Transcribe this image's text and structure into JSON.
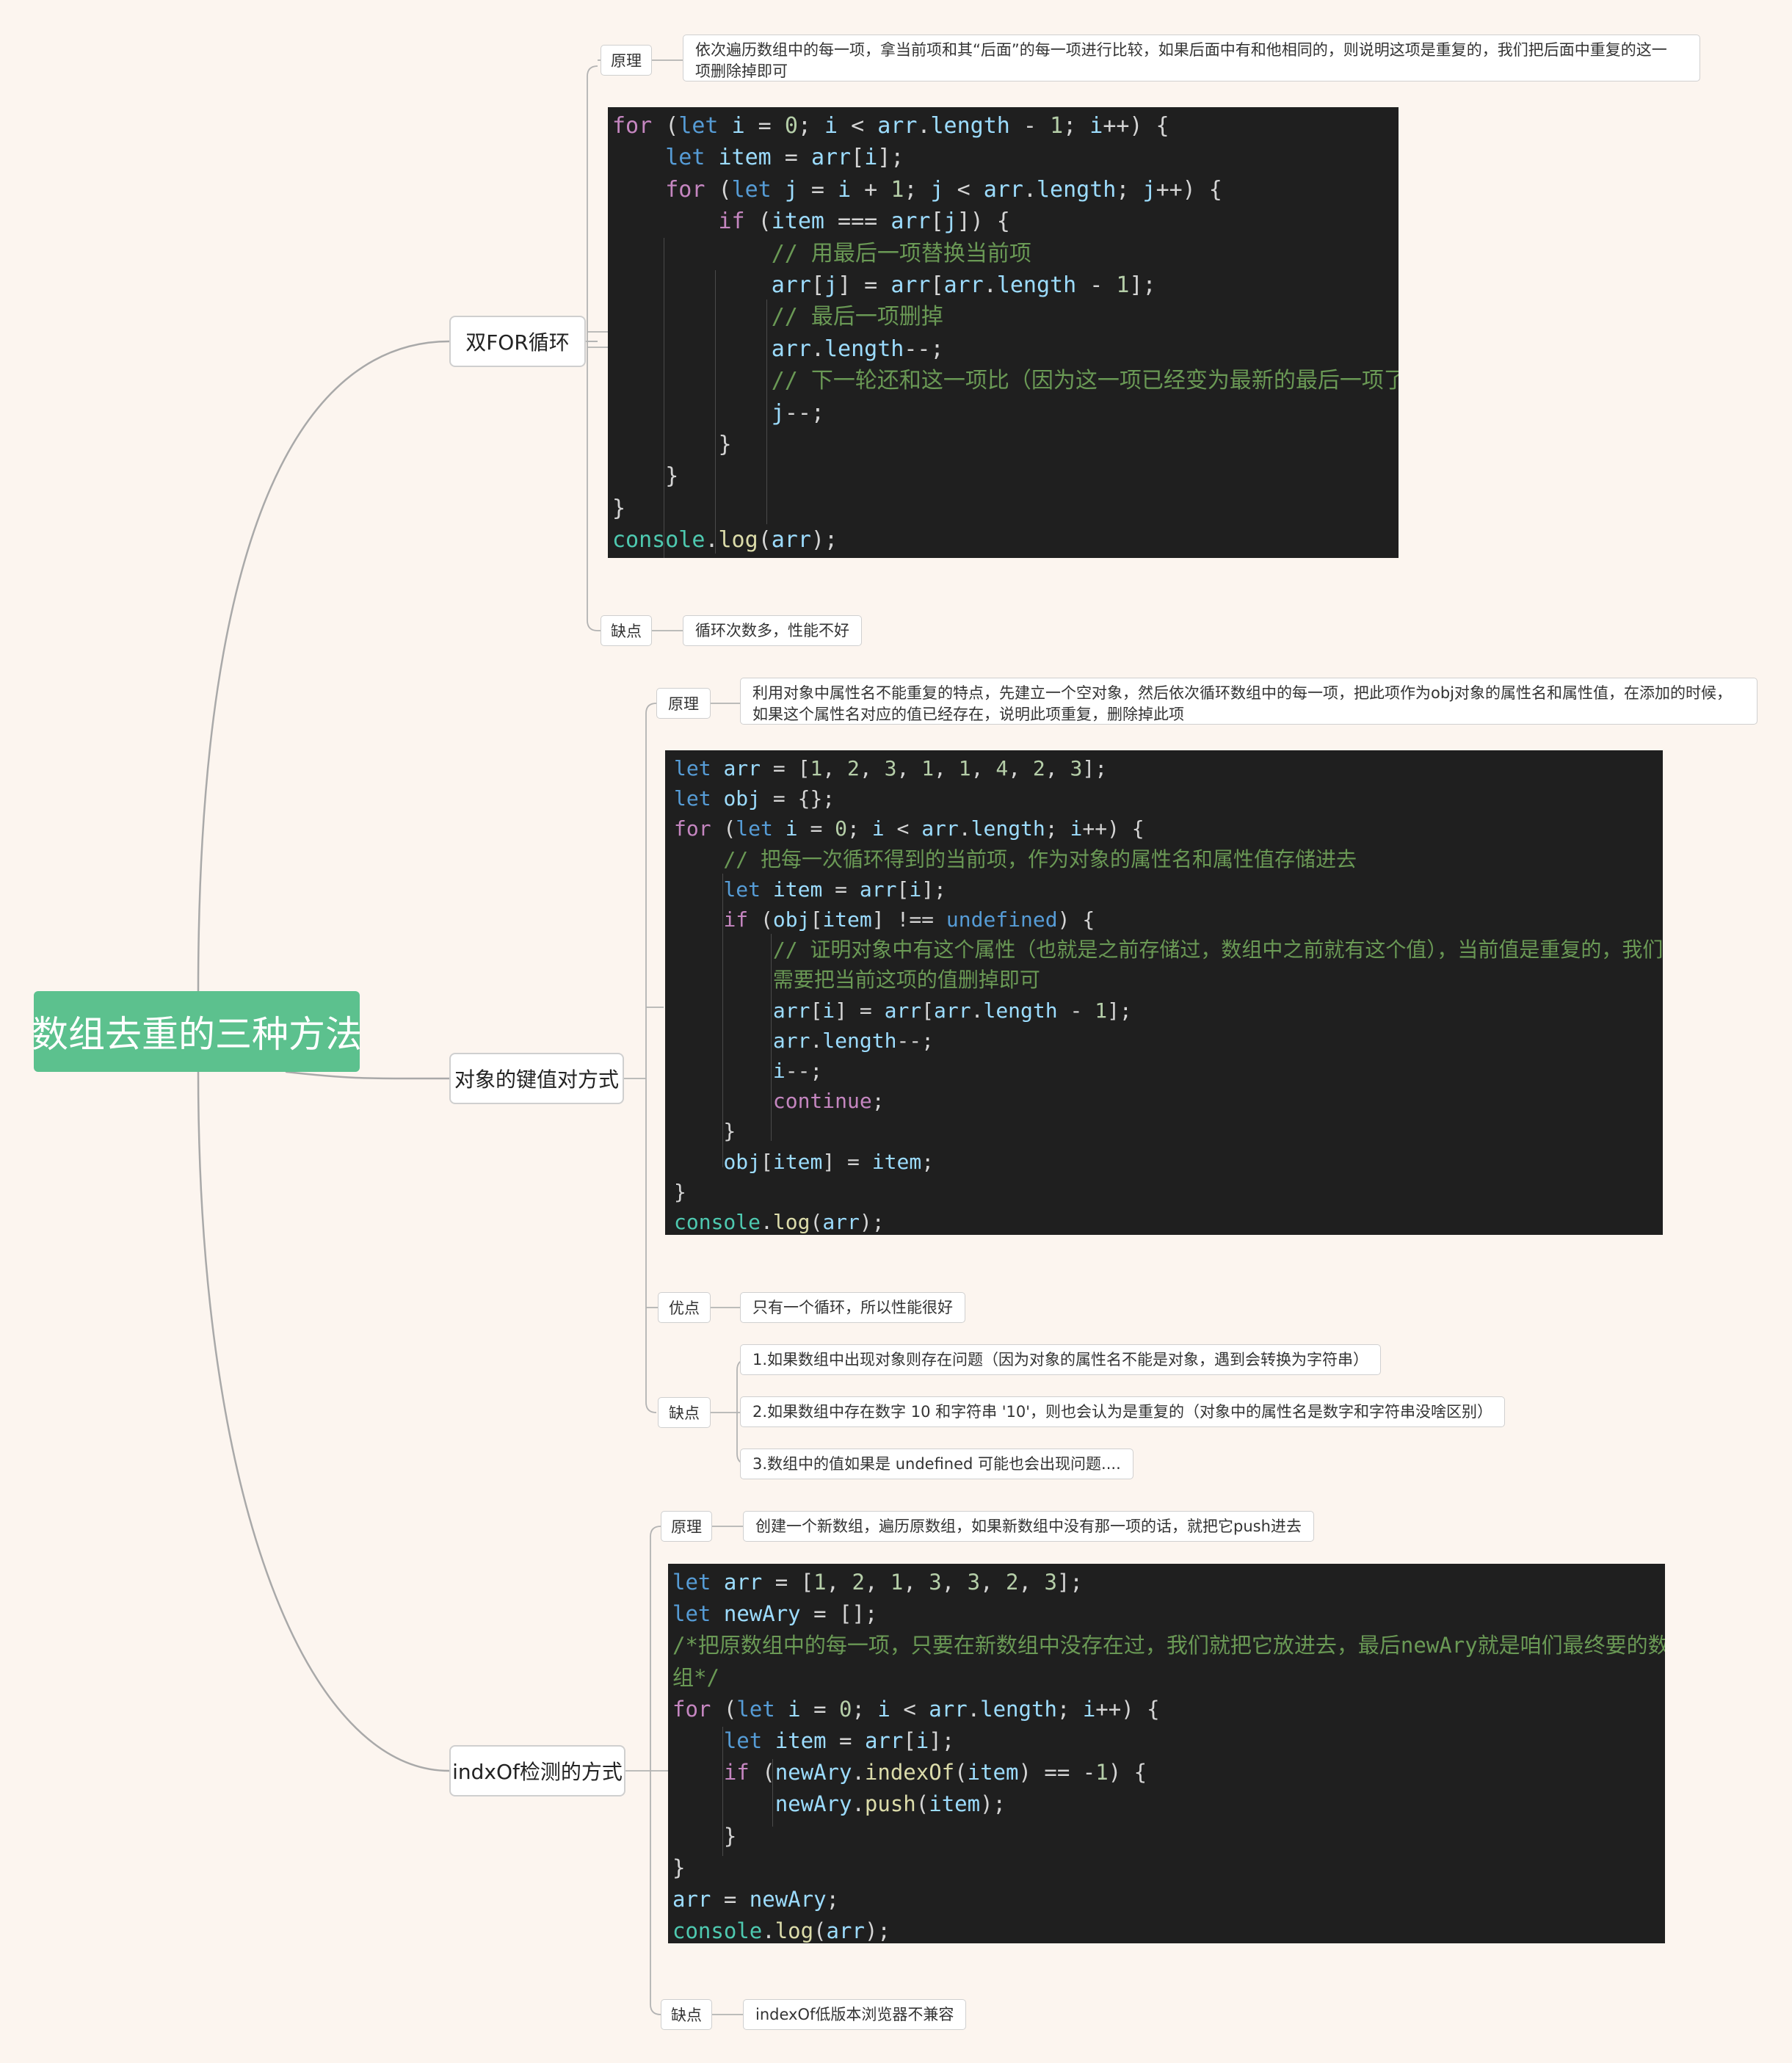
{
  "root": {
    "title": "数组去重的三种方法"
  },
  "methods": [
    {
      "name": "双FOR循环",
      "principle_label": "原理",
      "principle_lines": [
        "依次遍历数组中的每一项，拿当前项和其“后面”的每一项进行比较，如果后面中有和他相同的，则说明这项是重复的，我们把后面中重复的这一",
        "项删除掉即可"
      ],
      "cons_label": "缺点",
      "cons": [
        "循环次数多，性能不好"
      ]
    },
    {
      "name": "对象的键值对方式",
      "principle_label": "原理",
      "principle_lines": [
        "利用对象中属性名不能重复的特点，先建立一个空对象，然后依次循环数组中的每一项，把此项作为obj对象的属性名和属性值，在添加的时候，",
        "如果这个属性名对应的值已经存在，说明此项重复，删除掉此项"
      ],
      "pros_label": "优点",
      "pros": [
        "只有一个循环，所以性能很好"
      ],
      "cons_label": "缺点",
      "cons": [
        "1.如果数组中出现对象则存在问题（因为对象的属性名不能是对象，遇到会转换为字符串）",
        "2.如果数组中存在数字 10 和字符串 '10'，则也会认为是重复的（对象中的属性名是数字和字符串没啥区别）",
        "3.数组中的值如果是 undefined 可能也会出现问题...."
      ]
    },
    {
      "name": "indxOf检测的方式",
      "principle_label": "原理",
      "principle_lines": [
        "创建一个新数组，遍历原数组，如果新数组中没有那一项的话，就把它push进去"
      ],
      "cons_label": "缺点",
      "cons": [
        "indexOf低版本浏览器不兼容"
      ]
    }
  ],
  "code": {
    "double_for": [
      "for (let i = 0; i < arr.length - 1; i++) {",
      "    let item = arr[i];",
      "    for (let j = i + 1; j < arr.length; j++) {",
      "        if (item === arr[j]) {",
      "            // 用最后一项替换当前项",
      "            arr[j] = arr[arr.length - 1];",
      "            // 最后一项删掉",
      "            arr.length--;",
      "            // 下一轮还和这一项比（因为这一项已经变为最新的最后一项了）",
      "            j--;",
      "        }",
      "    }",
      "}",
      "console.log(arr);"
    ],
    "object_map": [
      "let arr = [1, 2, 3, 1, 1, 4, 2, 3];",
      "let obj = {};",
      "for (let i = 0; i < arr.length; i++) {",
      "    // 把每一次循环得到的当前项，作为对象的属性名和属性值存储进去",
      "    let item = arr[i];",
      "    if (obj[item] !== undefined) {",
      "        // 证明对象中有这个属性（也就是之前存储过，数组中之前就有这个值），当前值是重复的，我们",
      "        需要把当前这项的值删掉即可",
      "        arr[i] = arr[arr.length - 1];",
      "        arr.length--;",
      "        i--;",
      "        continue;",
      "    }",
      "    obj[item] = item;",
      "}",
      "console.log(arr);"
    ],
    "index_of": [
      "let arr = [1, 2, 1, 3, 3, 2, 3];",
      "let newAry = [];",
      "/*把原数组中的每一项，只要在新数组中没存在过，我们就把它放进去，最后newAry就是咱们最终要的数",
      "组*/",
      "for (let i = 0; i < arr.length; i++) {",
      "    let item = arr[i];",
      "    if (newAry.indexOf(item) == -1) {",
      "        newAry.push(item);",
      "    }",
      "}",
      "arr = newAry;",
      "console.log(arr);"
    ]
  },
  "colors": {
    "root_bg": "#5cc18e",
    "canvas_bg": "#fcf5ef",
    "code_bg": "#1f1f1f",
    "comment": "#6a9955",
    "keyword": "#c586c0",
    "declare": "#569cd6",
    "number": "#b5cea8"
  }
}
